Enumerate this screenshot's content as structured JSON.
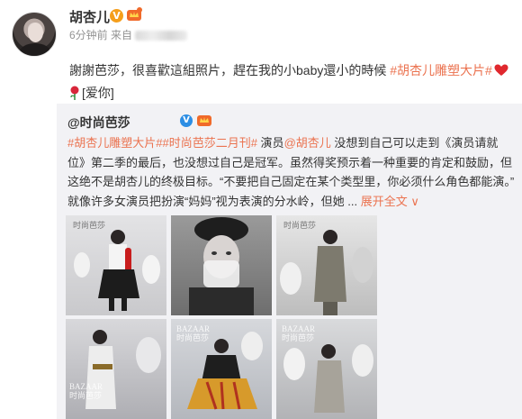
{
  "post": {
    "username": "胡杏儿",
    "verified_mark": "V",
    "time": "6分钟前",
    "source_prefix": "来自",
    "text_main": "謝謝芭莎，很喜歡這組照片，趕在我的小baby還小的時候 ",
    "hashtag": "#胡杏儿雕塑大片#",
    "text_end": "[爱你]",
    "heart_color": "#e0282e",
    "link_color": "#eb7350"
  },
  "repost": {
    "author": "@时尚芭莎",
    "verified_mark": "V",
    "hashtag1": "#胡杏儿雕塑大片#",
    "hashtag2": "#时尚芭莎二月刊#",
    "text_a": " 演员",
    "mention": "@胡杏儿",
    "text_b": " 没想到自己可以走到《演员请就位》第二季的最后，也没想过自己是冠军。虽然得奖预示着一种重要的肯定和鼓励，但这绝不是胡杏儿的终极目标。“不要把自己固定在某个类型里，你必须什么角色都能演。” 就像许多女演员把扮演“妈妈”视为表演的分水岭，但她 ... ",
    "more_label": "展开全文",
    "more_arrow": "∨",
    "photos": [
      {
        "watermark": "时尚芭莎"
      },
      {
        "watermark": ""
      },
      {
        "watermark": "时尚芭莎"
      },
      {
        "watermark": "BAZAAR\n时尚芭莎"
      },
      {
        "watermark": "BAZAAR\n时尚芭莎"
      },
      {
        "watermark": "BAZAAR\n时尚芭莎"
      }
    ]
  }
}
